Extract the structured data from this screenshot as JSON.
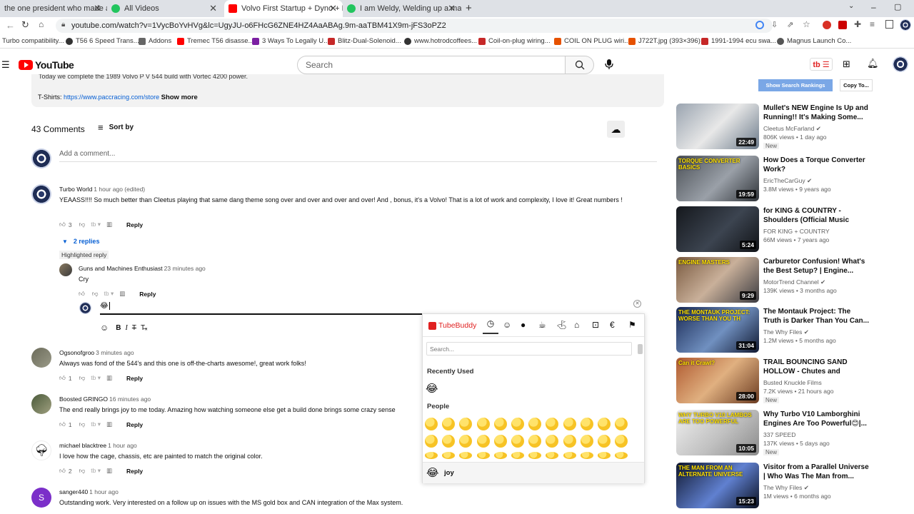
{
  "browser": {
    "tabs": [
      {
        "label": "the one president who made am",
        "icon": "chrome-icon",
        "active": false
      },
      {
        "label": "All Videos",
        "icon": "video-icon",
        "active": false
      },
      {
        "label": "Volvo First Startup + Dyno + Firs",
        "icon": "youtube-icon",
        "active": true
      },
      {
        "label": "I am Weldy, Welding up a manifo",
        "icon": "video-icon",
        "active": false
      }
    ],
    "new_tab": "+",
    "url": "youtube.com/watch?v=1VycBoYvHVg&lc=UgyJU-o6FHcG6ZNE4HZ4AaABAg.9m-aaTBM41X9m-jFS3oPZ2",
    "bookmarks": [
      "Turbo compatibility...",
      "T56 6 Speed Trans...",
      "Addons",
      "Tremec T56 disasse...",
      "3 Ways To Legally U...",
      "Blitz-Dual-Solenoid...",
      "www.hotrodcoffees...",
      "Coil-on-plug wiring...",
      "COIL ON PLUG wiri...",
      "J722T.jpg (393×396)",
      "1991-1994 ecu swa...",
      "Magnus Launch Co..."
    ]
  },
  "yt": {
    "logo": "YouTube",
    "search_placeholder": "Search",
    "show_rankings": "Show Search Rankings",
    "copy_to": "Copy To..."
  },
  "description": {
    "line1": "Today we complete the 1989 Volvo P V 544 build with Vortec 4200 power.",
    "tshirts_label": "T-Shirts:",
    "tshirts_link": "https://www.paccracing.com/store",
    "show_more": "Show more"
  },
  "comments_header": {
    "count": "43 Comments",
    "sort_by": "Sort by",
    "add_comment": "Add a comment..."
  },
  "comments": [
    {
      "author": "Turbo World",
      "time": "1 hour ago (edited)",
      "text": "YEAASS!!!! So much better than Cleetus playing that same dang theme song over and over and over and over! And , bonus, it's a Volvo! That is a lot of work and complexity, I love it! Great numbers !",
      "likes": "3",
      "reply": "Reply",
      "replies_toggle": "2 replies"
    },
    {
      "author": "Ogsonofgroo",
      "time": "3 minutes ago",
      "text": "Always was fond of the 544's and this one is off-the-charts awesome!, great work folks!",
      "likes": "1",
      "reply": "Reply"
    },
    {
      "author": "Boosted GRINGO",
      "time": "16 minutes ago",
      "text": "The end really brings joy to me today. Amazing how watching someone else get a build done brings some crazy sense",
      "likes": "1",
      "reply": "Reply"
    },
    {
      "author": "michael blacktree",
      "time": "1 hour ago",
      "text": "I love how the cage, chassis, etc are painted to match the original color.",
      "likes": "2",
      "reply": "Reply"
    },
    {
      "author": "sanger440",
      "time": "1 hour ago",
      "text": "Outstanding work.  Very interested on a follow up on issues with the MS gold box and CAN integration of the Max system.",
      "avatar_letter": "S"
    }
  ],
  "highlighted": {
    "label": "Highlighted reply",
    "author": "Guns and Machines Enthusiast",
    "time": "23 minutes ago",
    "text": "Cry",
    "reply": "Reply",
    "draft": "😂"
  },
  "picker": {
    "brand": "TubeBuddy",
    "search_placeholder": "Search...",
    "recently_used": "Recently Used",
    "people": "People",
    "preview_name": "joy",
    "recent_emoji": "😂"
  },
  "sidebar": [
    {
      "title": "Mullet's NEW Engine Is Up and Running!! It's Making Some...",
      "channel": "Cleetus McFarland",
      "meta": "806K views • 1 day ago",
      "badge": "New",
      "duration": "22:49",
      "verified": true
    },
    {
      "title": "How Does a Torque Converter Work?",
      "channel": "EricTheCarGuy",
      "meta": "3.8M views • 9 years ago",
      "badge": "",
      "duration": "19:59",
      "verified": true,
      "thumb_text": "TORQUE CONVERTER BASICS"
    },
    {
      "title": "for KING & COUNTRY - Shoulders (Official Music Video)",
      "channel": "FOR KING + COUNTRY",
      "meta": "66M views • 7 years ago",
      "badge": "",
      "duration": "5:24",
      "verified": false
    },
    {
      "title": "Carburetor Confusion! What's the Best Setup? | Engine...",
      "channel": "MotorTrend Channel",
      "meta": "139K views • 3 months ago",
      "badge": "",
      "duration": "9:29",
      "verified": true,
      "thumb_text": "ENGINE MASTERS"
    },
    {
      "title": "The Montauk Project: The Truth is Darker Than You Can...",
      "channel": "The Why Files",
      "meta": "1.2M views • 5 months ago",
      "badge": "",
      "duration": "31:04",
      "verified": true,
      "thumb_text": "THE MONTAUK PROJECT: WORSE THAN YOU TH"
    },
    {
      "title": "TRAIL BOUNCING SAND HOLLOW - Chutes and Ladders",
      "channel": "Busted Knuckle Films",
      "meta": "7.2K views • 21 hours ago",
      "badge": "New",
      "duration": "28:00",
      "verified": false,
      "thumb_text": "Can it Crawl?"
    },
    {
      "title": "Why Turbo V10 Lamborghini Engines Are Too Powerful😊|...",
      "channel": "337 SPEED",
      "meta": "137K views • 5 days ago",
      "badge": "New",
      "duration": "10:05",
      "verified": false,
      "thumb_text": "WHY TURBO V10 LAMBOS ARE TOO POWERFUL"
    },
    {
      "title": "Visitor from a Parallel Universe | Who Was The Man from...",
      "channel": "The Why Files",
      "meta": "1M views • 6 months ago",
      "badge": "",
      "duration": "15:23",
      "verified": true,
      "thumb_text": "THE MAN FROM AN ALTERNATE UNIVERSE"
    }
  ],
  "colors": {
    "yt_red": "#ff0000",
    "link_blue": "#065fd4",
    "tb_blue": "#7aa7e6"
  }
}
